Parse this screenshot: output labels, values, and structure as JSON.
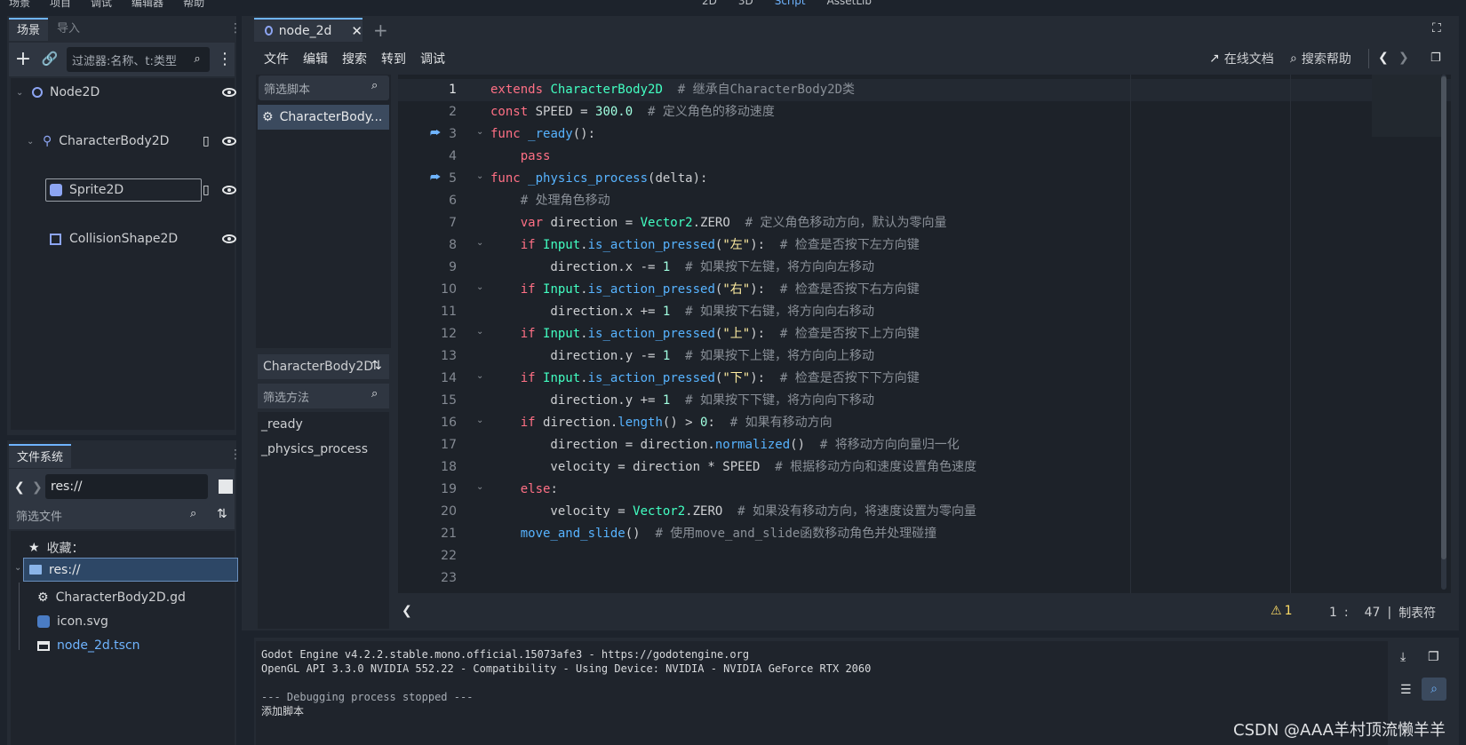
{
  "top_menu": {
    "items": [
      "场景",
      "项目",
      "调试",
      "编辑器",
      "帮助"
    ],
    "center_tabs": [
      "2D",
      "3D",
      "Script",
      "AssetLib"
    ]
  },
  "scene_panel": {
    "tabs": [
      "场景",
      "导入"
    ],
    "filter_placeholder": "过滤器:名称、t:类型",
    "nodes": [
      {
        "label": "Node2D",
        "depth": 0,
        "icon": "node2d-icon"
      },
      {
        "label": "CharacterBody2D",
        "depth": 1,
        "icon": "characterbody2d-icon"
      },
      {
        "label": "Sprite2D",
        "depth": 2,
        "icon": "sprite2d-icon"
      },
      {
        "label": "CollisionShape2D",
        "depth": 2,
        "icon": "collisionshape2d-icon"
      }
    ]
  },
  "filesystem_panel": {
    "title": "文件系统",
    "path": "res://",
    "filter_placeholder": "筛选文件",
    "favorites_label": "收藏：",
    "items": [
      {
        "label": "res://",
        "icon": "folder-icon"
      },
      {
        "label": "CharacterBody2D.gd",
        "icon": "gear-icon"
      },
      {
        "label": "icon.svg",
        "icon": "image-icon"
      },
      {
        "label": "node_2d.tscn",
        "icon": "clapper-icon"
      }
    ]
  },
  "script_editor": {
    "tab_label": "node_2d",
    "menu": [
      "文件",
      "编辑",
      "搜索",
      "转到",
      "调试"
    ],
    "online_docs": "在线文档",
    "search_help": "搜索帮助",
    "filter_scripts_placeholder": "筛选脚本",
    "scripts": [
      "CharacterBody..."
    ],
    "current_class": "CharacterBody2D",
    "filter_methods_placeholder": "筛选方法",
    "methods": [
      "_ready",
      "_physics_process"
    ],
    "status": {
      "warnings": "1",
      "line": "1",
      "col": "47",
      "indent": "制表符"
    }
  },
  "code_lines": [
    [
      [
        "kw",
        "extends "
      ],
      [
        "ty",
        "CharacterBody2D"
      ],
      [
        "cm",
        "  # 继承自CharacterBody2D类"
      ]
    ],
    [
      [
        "kw",
        "const "
      ],
      [
        "pl",
        "SPEED = "
      ],
      [
        "num",
        "300.0"
      ],
      [
        "cm",
        "  # 定义角色的移动速度"
      ]
    ],
    [
      [
        "kw",
        "func "
      ],
      [
        "fn",
        "_ready"
      ],
      [
        "pl",
        "():"
      ]
    ],
    [
      [
        "pl",
        "    "
      ],
      [
        "kw",
        "pass"
      ]
    ],
    [
      [
        "kw",
        "func "
      ],
      [
        "fn",
        "_physics_process"
      ],
      [
        "pl",
        "(delta):"
      ]
    ],
    [
      [
        "pl",
        "    "
      ],
      [
        "cm",
        "# 处理角色移动"
      ]
    ],
    [
      [
        "pl",
        "    "
      ],
      [
        "kw",
        "var "
      ],
      [
        "pl",
        "direction = "
      ],
      [
        "ty",
        "Vector2"
      ],
      [
        "pl",
        ".ZERO"
      ],
      [
        "cm",
        "  # 定义角色移动方向，默认为零向量"
      ]
    ],
    [
      [
        "pl",
        "    "
      ],
      [
        "kw",
        "if "
      ],
      [
        "ty",
        "Input"
      ],
      [
        "pl",
        "."
      ],
      [
        "fn",
        "is_action_pressed"
      ],
      [
        "pl",
        "("
      ],
      [
        "str",
        "\"左\""
      ],
      [
        "pl",
        "):"
      ],
      [
        "cm",
        "  # 检查是否按下左方向键"
      ]
    ],
    [
      [
        "pl",
        "        direction.x -= "
      ],
      [
        "num",
        "1"
      ],
      [
        "cm",
        "  # 如果按下左键，将方向向左移动"
      ]
    ],
    [
      [
        "pl",
        "    "
      ],
      [
        "kw",
        "if "
      ],
      [
        "ty",
        "Input"
      ],
      [
        "pl",
        "."
      ],
      [
        "fn",
        "is_action_pressed"
      ],
      [
        "pl",
        "("
      ],
      [
        "str",
        "\"右\""
      ],
      [
        "pl",
        "):"
      ],
      [
        "cm",
        "  # 检查是否按下右方向键"
      ]
    ],
    [
      [
        "pl",
        "        direction.x += "
      ],
      [
        "num",
        "1"
      ],
      [
        "cm",
        "  # 如果按下右键，将方向向右移动"
      ]
    ],
    [
      [
        "pl",
        "    "
      ],
      [
        "kw",
        "if "
      ],
      [
        "ty",
        "Input"
      ],
      [
        "pl",
        "."
      ],
      [
        "fn",
        "is_action_pressed"
      ],
      [
        "pl",
        "("
      ],
      [
        "str",
        "\"上\""
      ],
      [
        "pl",
        "):"
      ],
      [
        "cm",
        "  # 检查是否按下上方向键"
      ]
    ],
    [
      [
        "pl",
        "        direction.y -= "
      ],
      [
        "num",
        "1"
      ],
      [
        "cm",
        "  # 如果按下上键，将方向向上移动"
      ]
    ],
    [
      [
        "pl",
        "    "
      ],
      [
        "kw",
        "if "
      ],
      [
        "ty",
        "Input"
      ],
      [
        "pl",
        "."
      ],
      [
        "fn",
        "is_action_pressed"
      ],
      [
        "pl",
        "("
      ],
      [
        "str",
        "\"下\""
      ],
      [
        "pl",
        "):"
      ],
      [
        "cm",
        "  # 检查是否按下下方向键"
      ]
    ],
    [
      [
        "pl",
        "        direction.y += "
      ],
      [
        "num",
        "1"
      ],
      [
        "cm",
        "  # 如果按下下键，将方向向下移动"
      ]
    ],
    [
      [
        "pl",
        "    "
      ],
      [
        "kw",
        "if "
      ],
      [
        "pl",
        "direction."
      ],
      [
        "fn",
        "length"
      ],
      [
        "pl",
        "() > "
      ],
      [
        "num",
        "0"
      ],
      [
        "pl",
        ":"
      ],
      [
        "cm",
        "  # 如果有移动方向"
      ]
    ],
    [
      [
        "pl",
        "        direction = direction."
      ],
      [
        "fn",
        "normalized"
      ],
      [
        "pl",
        "()"
      ],
      [
        "cm",
        "  # 将移动方向向量归一化"
      ]
    ],
    [
      [
        "pl",
        "        velocity = direction * SPEED"
      ],
      [
        "cm",
        "  # 根据移动方向和速度设置角色速度"
      ]
    ],
    [
      [
        "pl",
        "    "
      ],
      [
        "kw",
        "else"
      ],
      [
        "pl",
        ":"
      ]
    ],
    [
      [
        "pl",
        "        velocity = "
      ],
      [
        "ty",
        "Vector2"
      ],
      [
        "pl",
        ".ZERO"
      ],
      [
        "cm",
        "  # 如果没有移动方向，将速度设置为零向量"
      ]
    ],
    [
      [
        "pl",
        "    "
      ],
      [
        "fn",
        "move_and_slide"
      ],
      [
        "pl",
        "()"
      ],
      [
        "cm",
        "  # 使用move_and_slide函数移动角色并处理碰撞"
      ]
    ],
    [],
    []
  ],
  "output": {
    "lines": [
      "Godot Engine v4.2.2.stable.mono.official.15073afe3 - https://godotengine.org",
      "OpenGL API 3.3.0 NVIDIA 552.22 - Compatibility - Using Device: NVIDIA - NVIDIA GeForce RTX 2060",
      "",
      "--- Debugging process stopped ---",
      "添加脚本"
    ]
  },
  "watermark": "CSDN @AAA羊村顶流懒羊羊"
}
